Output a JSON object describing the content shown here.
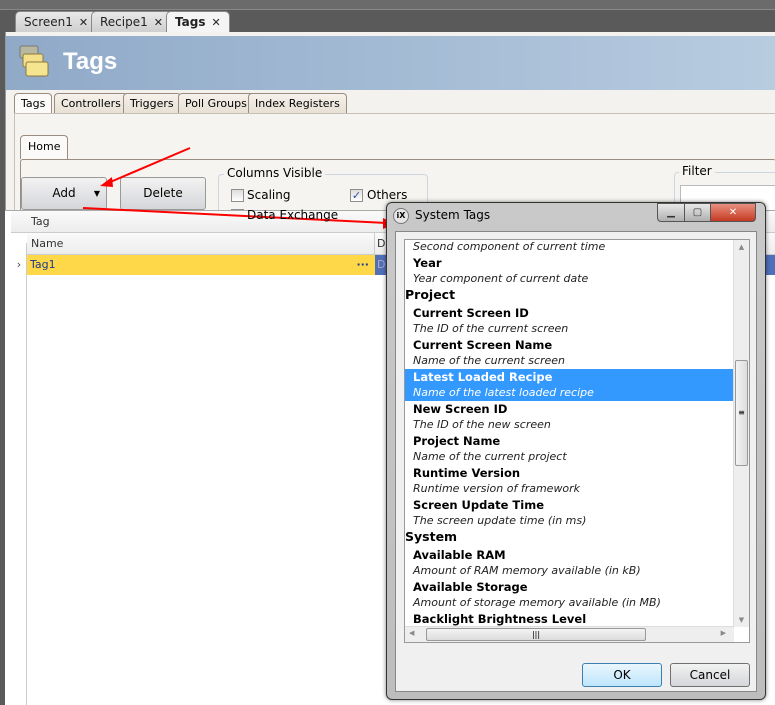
{
  "doc_tabs": [
    {
      "label": "Screen1",
      "close": "✕"
    },
    {
      "label": "Recipe1",
      "close": "✕"
    },
    {
      "label": "Tags",
      "close": "✕",
      "active": true
    }
  ],
  "header": {
    "title": "Tags",
    "icon": "tags-icon"
  },
  "inner_tabs": [
    "Tags",
    "Controllers",
    "Triggers",
    "Poll Groups",
    "Index Registers"
  ],
  "ribbon": {
    "home_tab": "Home",
    "add_label": "Add",
    "delete_label": "Delete",
    "columns_visible": {
      "label": "Columns Visible",
      "items": [
        {
          "label": "Scaling",
          "checked": false
        },
        {
          "label": "Others",
          "checked": true
        },
        {
          "label": "Data Exchange",
          "checked": false
        }
      ]
    },
    "filter_label": "Filter"
  },
  "grid": {
    "group_header": "Tag",
    "columns": [
      "Name",
      "D"
    ],
    "rows": [
      {
        "name": "Tag1",
        "ellipsis": "···",
        "col2": "D"
      }
    ]
  },
  "dialog": {
    "title": "System Tags",
    "icon_text": "iX",
    "items": [
      {
        "type": "desc",
        "text": "Second component of current time"
      },
      {
        "type": "name",
        "text": "Year"
      },
      {
        "type": "desc",
        "text": "Year component of current date"
      },
      {
        "type": "cat",
        "text": "Project"
      },
      {
        "type": "name",
        "text": "Current Screen ID"
      },
      {
        "type": "desc",
        "text": "The ID of the current screen"
      },
      {
        "type": "name",
        "text": "Current Screen Name"
      },
      {
        "type": "desc",
        "text": "Name of the current screen"
      },
      {
        "type": "name",
        "text": "Latest Loaded Recipe",
        "selected": true
      },
      {
        "type": "desc",
        "text": "Name of the latest loaded recipe",
        "selected": true
      },
      {
        "type": "name",
        "text": "New Screen ID"
      },
      {
        "type": "desc",
        "text": "The ID of the new screen"
      },
      {
        "type": "name",
        "text": "Project Name"
      },
      {
        "type": "desc",
        "text": "Name of the current project"
      },
      {
        "type": "name",
        "text": "Runtime Version"
      },
      {
        "type": "desc",
        "text": "Runtime version of framework"
      },
      {
        "type": "name",
        "text": "Screen Update Time"
      },
      {
        "type": "desc",
        "text": "The screen update time (in ms)"
      },
      {
        "type": "cat",
        "text": "System"
      },
      {
        "type": "name",
        "text": "Available RAM"
      },
      {
        "type": "desc",
        "text": "Amount of RAM memory available (in kB)"
      },
      {
        "type": "name",
        "text": "Available Storage"
      },
      {
        "type": "desc",
        "text": "Amount of storage memory available (in MB)"
      },
      {
        "type": "name",
        "text": "Backlight Brightness Level"
      }
    ],
    "ok_label": "OK",
    "cancel_label": "Cancel",
    "selection_color": "#3399ff"
  },
  "colors": {
    "selected_row": "#ffd84a",
    "annotation_arrow": "#ff0000"
  }
}
